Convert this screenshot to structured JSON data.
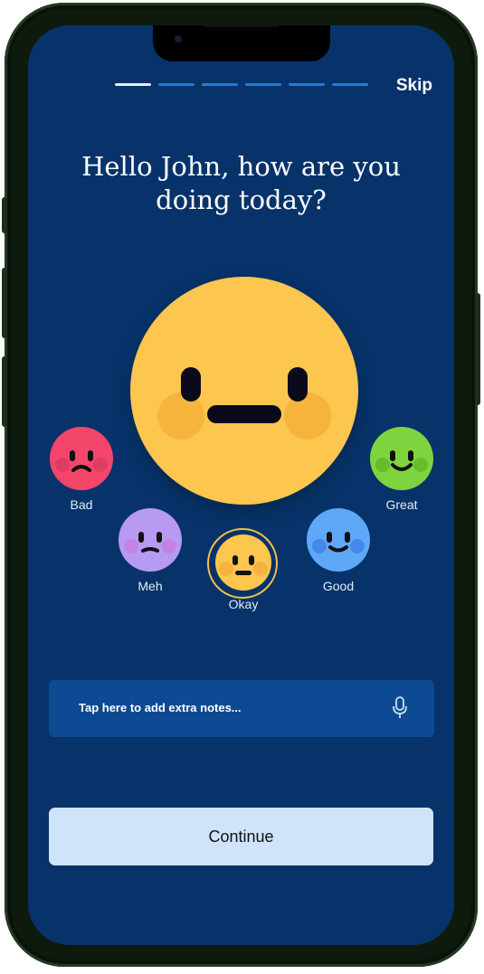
{
  "header": {
    "skip_label": "Skip",
    "progress_total": 6,
    "progress_current": 1
  },
  "prompt": {
    "title": "Hello John, how are you doing today?"
  },
  "selected_mood": "Okay",
  "moods": [
    {
      "label": "Bad",
      "color": "#f4456b"
    },
    {
      "label": "Meh",
      "color": "#b79af2"
    },
    {
      "label": "Okay",
      "color": "#fcc64f"
    },
    {
      "label": "Good",
      "color": "#5ea8f7"
    },
    {
      "label": "Great",
      "color": "#7ed43f"
    }
  ],
  "notes": {
    "placeholder": "Tap here to add extra notes...",
    "icon": "microphone-icon"
  },
  "actions": {
    "continue_label": "Continue"
  }
}
